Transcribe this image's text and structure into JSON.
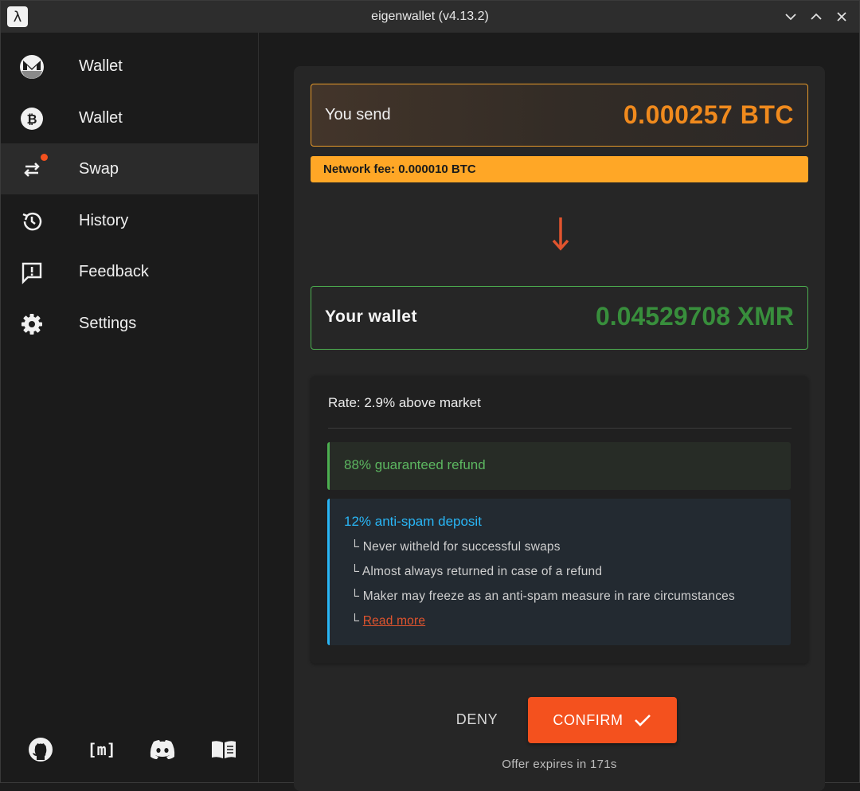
{
  "window": {
    "title": "eigenwallet (v4.13.2)",
    "app_icon_glyph": "λ"
  },
  "sidebar": {
    "items": [
      {
        "label": "Wallet",
        "icon": "monero-icon"
      },
      {
        "label": "Wallet",
        "icon": "bitcoin-icon"
      },
      {
        "label": "Swap",
        "icon": "swap-icon",
        "active": true,
        "badge": true
      },
      {
        "label": "History",
        "icon": "history-icon"
      },
      {
        "label": "Feedback",
        "icon": "feedback-icon"
      },
      {
        "label": "Settings",
        "icon": "gear-icon"
      }
    ],
    "footer_icons": [
      "github-icon",
      "matrix-icon",
      "discord-icon",
      "book-icon"
    ],
    "matrix_glyph": "[m]"
  },
  "swap": {
    "send_label": "You send",
    "send_amount": "0.000257 BTC",
    "network_fee": "Network fee: 0.000010 BTC",
    "wallet_label": "Your wallet",
    "wallet_amount": "0.04529708 XMR",
    "rate": "Rate: 2.9% above market",
    "refund": "88% guaranteed refund",
    "deposit_title": "12% anti-spam deposit",
    "deposit_lines": [
      "Never witheld for successful swaps",
      "Almost always returned in case of a refund",
      "Maker may freeze as an anti-spam measure in rare circumstances"
    ],
    "line_prefix": "└",
    "read_more": "Read more",
    "deny_label": "DENY",
    "confirm_label": "CONFIRM",
    "expires": "Offer expires in 171s"
  },
  "colors": {
    "accent": "#f4511e",
    "btc_orange": "#f08a1d",
    "fee_bg": "#ffa726",
    "xmr_green": "#388e3c",
    "refund_green": "#4caf50",
    "deposit_blue": "#29b6f6"
  }
}
